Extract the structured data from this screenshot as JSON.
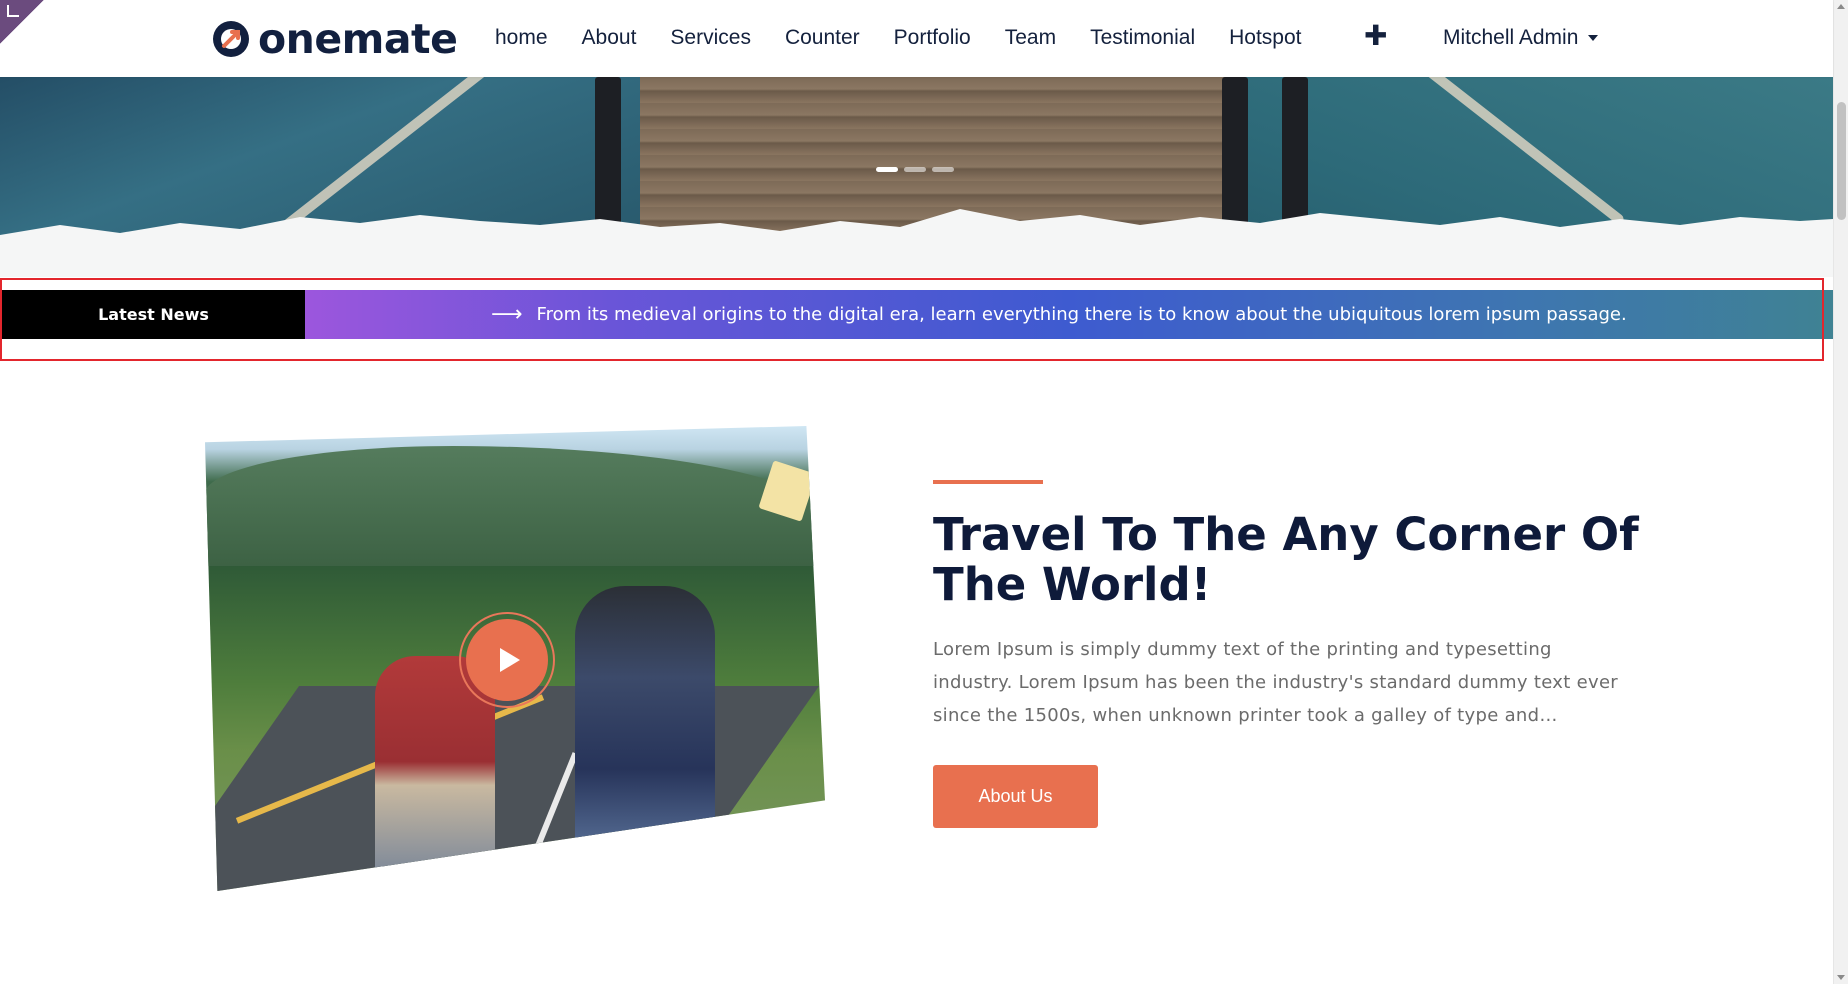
{
  "brand": {
    "name": "onemate",
    "colors": {
      "navy": "#0e1a3a",
      "accent": "#e8704f",
      "ticker_start": "#9c56dd",
      "ticker_end": "#3f8293"
    }
  },
  "nav": {
    "items": [
      {
        "label": "home"
      },
      {
        "label": "About"
      },
      {
        "label": "Services"
      },
      {
        "label": "Counter"
      },
      {
        "label": "Portfolio"
      },
      {
        "label": "Team"
      },
      {
        "label": "Testimonial"
      },
      {
        "label": "Hotspot"
      }
    ],
    "plus_icon": "plus-icon",
    "plus_glyph": "✚",
    "user": "Mitchell Admin"
  },
  "hero": {
    "slides": 3,
    "active_slide": 1
  },
  "ticker": {
    "label": "Latest News",
    "arrow_glyph": "⟶",
    "text": "From its medieval origins to the digital era, learn everything there is to know about the ubiquitous lorem ipsum passage."
  },
  "about": {
    "heading": "Travel To The Any Corner Of The World!",
    "paragraph": "Lorem Ipsum is simply dummy text of the printing and typesetting industry. Lorem Ipsum has been the industry's standard dummy text ever since the 1500s, when unknown printer took a galley of type and…",
    "button": "About Us",
    "play_icon": "play-icon"
  }
}
